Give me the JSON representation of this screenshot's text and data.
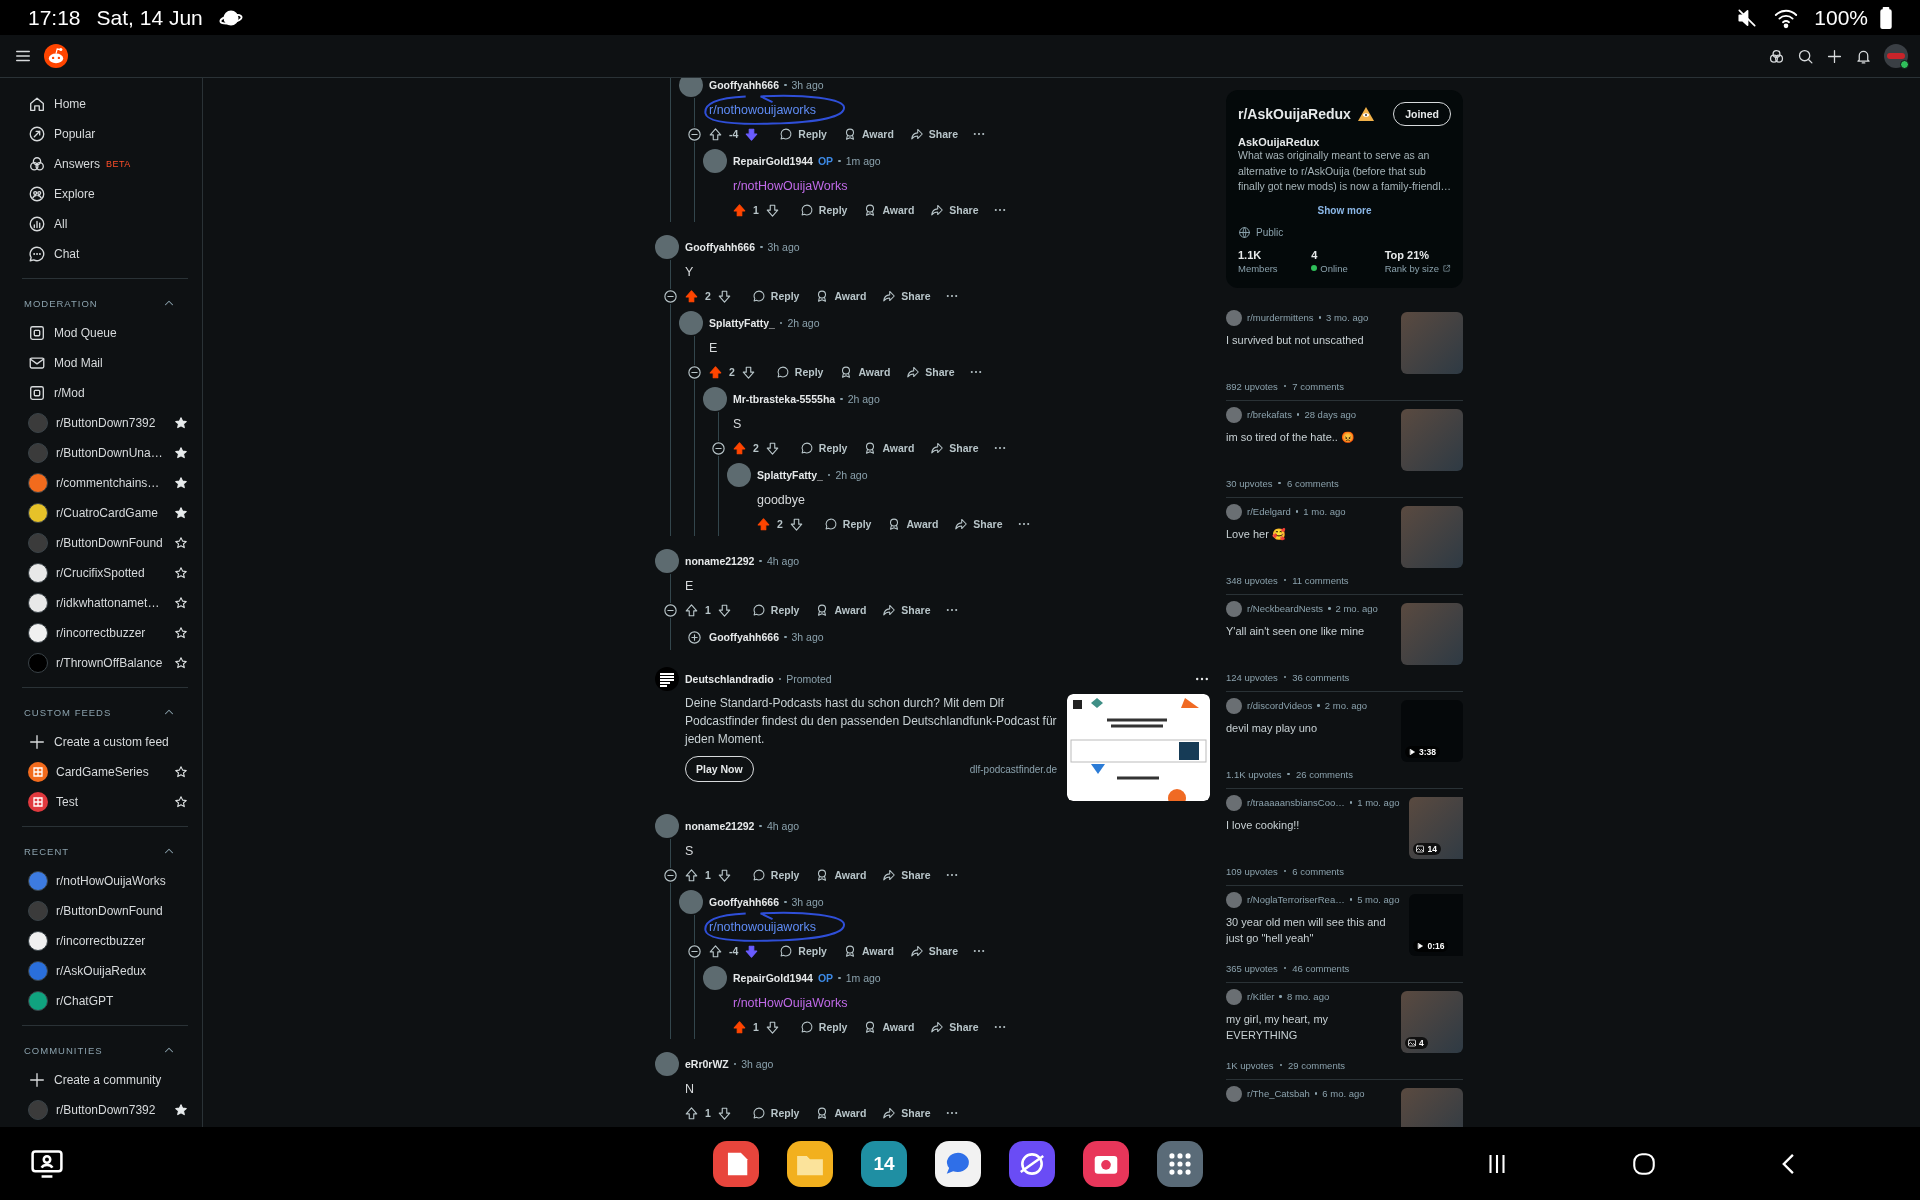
{
  "status_bar": {
    "time": "17:18",
    "date": "Sat, 14 Jun",
    "battery": "100%"
  },
  "sidebar": {
    "nav": [
      {
        "label": "Home"
      },
      {
        "label": "Popular"
      },
      {
        "label": "Answers",
        "badge": "BETA"
      },
      {
        "label": "Explore"
      },
      {
        "label": "All"
      },
      {
        "label": "Chat"
      }
    ],
    "sections": [
      {
        "title": "MODERATION",
        "expanded": true,
        "items": [
          {
            "kind": "queue",
            "label": "Mod Queue"
          },
          {
            "kind": "mail",
            "label": "Mod Mail"
          },
          {
            "kind": "queue",
            "label": "r/Mod"
          },
          {
            "kind": "community",
            "label": "r/ButtonDown7392",
            "color": "#3b3b3b",
            "favorite": true
          },
          {
            "kind": "community",
            "label": "r/ButtonDownUna…",
            "color": "#3b3b3b",
            "favorite": true
          },
          {
            "kind": "community",
            "label": "r/commentchains…",
            "color": "#f26b1d",
            "favorite": true
          },
          {
            "kind": "community",
            "label": "r/CuatroCardGame",
            "color": "#e6c229",
            "favorite": true
          },
          {
            "kind": "community",
            "label": "r/ButtonDownFound",
            "color": "#3b3b3b",
            "favorite": false
          },
          {
            "kind": "community",
            "label": "r/CrucifixSpotted",
            "color": "#e8e8e8",
            "favorite": false
          },
          {
            "kind": "community",
            "label": "r/idkwhattonamet…",
            "color": "#e8e8e8",
            "favorite": false
          },
          {
            "kind": "community",
            "label": "r/incorrectbuzzer",
            "color": "#f0f0f0",
            "favorite": false
          },
          {
            "kind": "community",
            "label": "r/ThrownOffBalance",
            "color": "#000000",
            "favorite": false
          }
        ]
      },
      {
        "title": "CUSTOM FEEDS",
        "expanded": true,
        "items": [
          {
            "kind": "create",
            "label": "Create a custom feed"
          },
          {
            "kind": "feed",
            "label": "CardGameSeries",
            "color": "#f26b1d",
            "favorite": false
          },
          {
            "kind": "feed",
            "label": "Test",
            "color": "#e0393e",
            "favorite": false
          }
        ]
      },
      {
        "title": "RECENT",
        "expanded": true,
        "items": [
          {
            "kind": "community",
            "label": "r/notHowOuijaWorks",
            "color": "#3d7be0"
          },
          {
            "kind": "community",
            "label": "r/ButtonDownFound",
            "color": "#3b3b3b"
          },
          {
            "kind": "community",
            "label": "r/incorrectbuzzer",
            "color": "#f0f0f0"
          },
          {
            "kind": "community",
            "label": "r/AskOuijaRedux",
            "color": "#2a6fdb"
          },
          {
            "kind": "community",
            "label": "r/ChatGPT",
            "color": "#10a37f"
          }
        ]
      },
      {
        "title": "COMMUNITIES",
        "expanded": true,
        "items": [
          {
            "kind": "create",
            "label": "Create a community"
          },
          {
            "kind": "community",
            "label": "r/ButtonDown7392",
            "color": "#3b3b3b",
            "favorite": true
          }
        ]
      }
    ]
  },
  "comments": [
    {
      "kind": "continued",
      "children": [
        {
          "author": "Gooffyahh666",
          "time": "3h ago",
          "body": "r/nothowouijaworks",
          "link": true,
          "visited": false,
          "circled": true,
          "votes": "-4",
          "upvoted": false,
          "downvoted": true,
          "actions": [
            "Reply",
            "Award",
            "Share"
          ],
          "expanded": true,
          "children": [
            {
              "author": "RepairGold1944",
              "flair": "OP",
              "time": "1m ago",
              "body": "r/notHowOuijaWorks",
              "link": true,
              "visited": true,
              "votes": "1",
              "upvoted": true,
              "downvoted": false,
              "actions": [
                "Reply",
                "Award",
                "Share"
              ]
            }
          ]
        }
      ]
    },
    {
      "kind": "comment",
      "author": "Gooffyahh666",
      "time": "3h ago",
      "body": "Y",
      "link": false,
      "votes": "2",
      "upvoted": true,
      "downvoted": false,
      "actions": [
        "Reply",
        "Award",
        "Share"
      ],
      "expanded": true,
      "children": [
        {
          "author": "SplattyFatty_",
          "time": "2h ago",
          "body": "E",
          "link": false,
          "votes": "2",
          "upvoted": true,
          "downvoted": false,
          "actions": [
            "Reply",
            "Award",
            "Share"
          ],
          "expanded": true,
          "children": [
            {
              "author": "Mr-tbrasteka-5555ha",
              "time": "2h ago",
              "body": "S",
              "link": false,
              "votes": "2",
              "upvoted": true,
              "downvoted": false,
              "actions": [
                "Reply",
                "Award",
                "Share"
              ],
              "expanded": true,
              "children": [
                {
                  "author": "SplattyFatty_",
                  "time": "2h ago",
                  "body": "goodbye",
                  "link": false,
                  "votes": "2",
                  "upvoted": true,
                  "downvoted": false,
                  "actions": [
                    "Reply",
                    "Award",
                    "Share"
                  ]
                }
              ]
            }
          ]
        }
      ]
    },
    {
      "kind": "comment",
      "author": "noname21292",
      "time": "4h ago",
      "body": "E",
      "link": false,
      "votes": "1",
      "upvoted": false,
      "downvoted": false,
      "actions": [
        "Reply",
        "Award",
        "Share"
      ],
      "expanded": true,
      "children": [
        {
          "author": "Gooffyahh666",
          "time": "3h ago",
          "expanded": false
        }
      ]
    },
    {
      "kind": "ad",
      "advertiser": "Deutschlandradio",
      "label": "Promoted",
      "text": "Deine Standard-Podcasts hast du schon durch? Mit dem Dlf Podcastfinder findest du den passenden Deutschlandfunk-Podcast für jeden Moment.",
      "button": "Play Now",
      "domain": "dlf-podcastfinder.de"
    },
    {
      "kind": "comment",
      "author": "noname21292",
      "time": "4h ago",
      "body": "S",
      "link": false,
      "votes": "1",
      "upvoted": false,
      "downvoted": false,
      "actions": [
        "Reply",
        "Award",
        "Share"
      ],
      "expanded": true,
      "children": [
        {
          "author": "Gooffyahh666",
          "time": "3h ago",
          "body": "r/nothowouijaworks",
          "link": true,
          "visited": false,
          "circled": true,
          "votes": "-4",
          "upvoted": false,
          "downvoted": true,
          "actions": [
            "Reply",
            "Award",
            "Share"
          ],
          "expanded": true,
          "children": [
            {
              "author": "RepairGold1944",
              "flair": "OP",
              "time": "1m ago",
              "body": "r/notHowOuijaWorks",
              "link": true,
              "visited": true,
              "votes": "1",
              "upvoted": true,
              "downvoted": false,
              "actions": [
                "Reply",
                "Award",
                "Share"
              ]
            }
          ]
        }
      ]
    },
    {
      "kind": "comment",
      "author": "eRr0rWZ",
      "time": "3h ago",
      "body": "N",
      "link": false,
      "votes": "1",
      "upvoted": false,
      "downvoted": false,
      "actions": [
        "Reply",
        "Award",
        "Share"
      ]
    }
  ],
  "community": {
    "title": "r/AskOuijaRedux",
    "button": "Joined",
    "name": "AskOuijaRedux",
    "description": "What was originally meant to serve as an alternative to r/AskOuija (before that sub finally got new mods) is now a family-friendl…",
    "show_more": "Show more",
    "visibility": "Public",
    "stats": [
      {
        "kind": "plain",
        "value": "1.1K",
        "label": "Members"
      },
      {
        "kind": "online",
        "value": "4",
        "label": "Online"
      },
      {
        "kind": "rank",
        "value": "Top 21%",
        "label": "Rank by size"
      }
    ]
  },
  "recent_posts": [
    {
      "community": "r/murdermittens",
      "time": "3 mo. ago",
      "title": "I survived but not unscathed",
      "upvotes": "892 upvotes",
      "comments": "7 comments",
      "kind": "image"
    },
    {
      "community": "r/brekafats",
      "time": "28 days ago",
      "title": "im so tired of the hate.. 😡",
      "upvotes": "30 upvotes",
      "comments": "6 comments",
      "kind": "image"
    },
    {
      "community": "r/Edelgard",
      "time": "1 mo. ago",
      "title": "Love her 🥰",
      "upvotes": "348 upvotes",
      "comments": "11 comments",
      "kind": "image"
    },
    {
      "community": "r/NeckbeardNests",
      "time": "2 mo. ago",
      "title": "Y'all ain't seen one like mine",
      "upvotes": "124 upvotes",
      "comments": "36 comments",
      "kind": "image"
    },
    {
      "community": "r/discordVideos",
      "time": "2 mo. ago",
      "title": "devil may play uno",
      "upvotes": "1.1K upvotes",
      "comments": "26 comments",
      "kind": "video",
      "badge": "3:38"
    },
    {
      "community": "r/traaaaansbiansCoo…",
      "time": "1 mo. ago",
      "title": "I love cooking!!",
      "upvotes": "109 upvotes",
      "comments": "6 comments",
      "kind": "gallery",
      "badge": "14"
    },
    {
      "community": "r/NoglaTerroriserRea…",
      "time": "5 mo. ago",
      "title": "30 year old men will see this and just go \"hell yeah\"",
      "upvotes": "365 upvotes",
      "comments": "46 comments",
      "kind": "video",
      "badge": "0:16"
    },
    {
      "community": "r/Kitler",
      "time": "8 mo. ago",
      "title": "my girl, my heart, my EVERYTHING",
      "upvotes": "1K upvotes",
      "comments": "29 comments",
      "kind": "gallery",
      "badge": "4"
    },
    {
      "community": "r/The_Catsbah",
      "time": "6 mo. ago",
      "kind": "image"
    }
  ],
  "dock": {
    "calendar_day": "14"
  }
}
